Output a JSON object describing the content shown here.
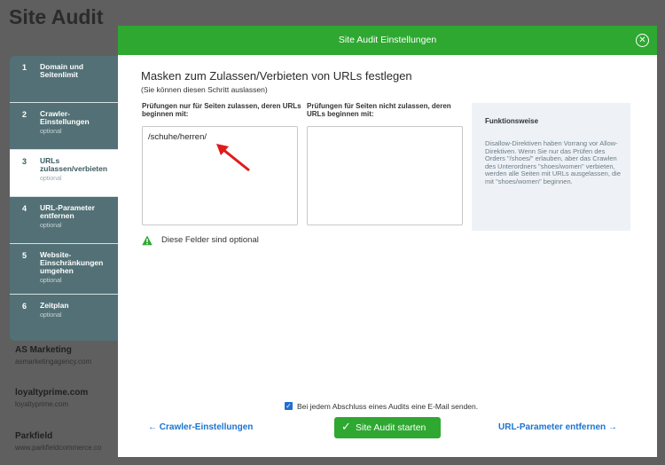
{
  "background": {
    "page_title": "Site Audit",
    "items": [
      {
        "name": "AS Marketing",
        "url": "asmarketingagency.com"
      },
      {
        "name": "loyaltyprime.com",
        "url": "loyaltyprime.com"
      },
      {
        "name": "Parkfield",
        "url": "www.parkfieldcommerce.co"
      }
    ]
  },
  "steps": [
    {
      "num": "1",
      "label": "Domain und Seitenlimit",
      "optional": ""
    },
    {
      "num": "2",
      "label": "Crawler-Einstellungen",
      "optional": "optional"
    },
    {
      "num": "3",
      "label": "URLs zulassen/verbieten",
      "optional": "optional",
      "active": true
    },
    {
      "num": "4",
      "label": "URL-Parameter entfernen",
      "optional": "optional"
    },
    {
      "num": "5",
      "label": "Website-Einschränkungen umgehen",
      "optional": "optional"
    },
    {
      "num": "6",
      "label": "Zeitplan",
      "optional": "optional"
    }
  ],
  "modal": {
    "title": "Site Audit Einstellungen",
    "close_icon": "close-icon",
    "heading": "Masken zum Zulassen/Verbieten von URLs festlegen",
    "subheading": "(Sie können diesen Schritt auslassen)",
    "allow_label": "Prüfungen nur für Seiten zulassen, deren URLs beginnen mit:",
    "allow_value": "/schuhe/herren/",
    "disallow_label": "Prüfungen für Seiten nicht zulassen, deren URLs beginnen mit:",
    "disallow_value": "",
    "info_title": "Funktionsweise",
    "info_text": "Disallow-Direktiven haben Vorrang vor Allow-Direktiven. Wenn Sie nur das Prüfen des Orders \"/shoes/\" erlauben, aber das Crawlen des Unterordners \"shoes/women\" verbieten, werden alle Seiten mit URLs ausgelassen, die mit \"shoes/women\" beginnen.",
    "optional_note": "Diese Felder sind optional",
    "email_checkbox_checked": true,
    "email_label": "Bei jedem Abschluss eines Audits eine E-Mail senden.",
    "back_link": "Crawler-Einstellungen",
    "start_button": "Site Audit starten",
    "next_link": "URL-Parameter entfernen"
  },
  "colors": {
    "header_green": "#2ea831",
    "link_blue": "#1b73d1",
    "sidebar_bg": "#527075",
    "arrow_red": "#e01b1b"
  }
}
